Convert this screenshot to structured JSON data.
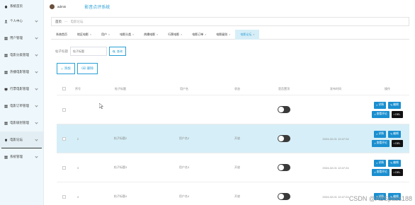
{
  "sidebar": {
    "logo_label": "系统首页",
    "items": [
      {
        "label": "个人中心",
        "icon": "user-icon"
      },
      {
        "label": "用户管理",
        "icon": "grid-icon"
      },
      {
        "label": "电影分类管理",
        "icon": "grid-icon"
      },
      {
        "label": "热播电影管理",
        "icon": "grid-icon"
      },
      {
        "label": "行票电影管理",
        "icon": "monitor-icon"
      },
      {
        "label": "电影订单管理",
        "icon": "grid-icon"
      },
      {
        "label": "电影级别管理",
        "icon": "grid-icon"
      },
      {
        "label": "电影论坛",
        "icon": "pin-icon"
      },
      {
        "label": "系统管理",
        "icon": "grid-icon"
      }
    ]
  },
  "topbar": {
    "username": "admin",
    "system_title": "影音点评系统"
  },
  "breadcrumb": {
    "home": "首页",
    "current": "电影论坛"
  },
  "tabs": [
    "系统首页",
    "地区电影",
    "用户",
    "电影分类",
    "热播电影",
    "行票电影",
    "电影订单",
    "电影级别",
    "电影论坛"
  ],
  "search": {
    "label": "帖子标题",
    "placeholder": "帖子标题",
    "button": "查询"
  },
  "actions": {
    "add": "添加",
    "delete": "删除"
  },
  "table": {
    "headers": [
      "序号",
      "帖子标题",
      "用户名",
      "状态",
      "是否置顶",
      "发布时间",
      "操作"
    ],
    "rows": [
      {
        "index": "",
        "title": "",
        "user": "",
        "status": "",
        "time": ""
      },
      {
        "index": "2",
        "title": "帖子标题2",
        "user": "用户名2",
        "status": "开放",
        "time": "2024-02-01 12:47:24"
      },
      {
        "index": "3",
        "title": "帖子标题3",
        "user": "用户名3",
        "status": "开放",
        "time": "2024-02-01 12:47:24"
      },
      {
        "index": "4",
        "title": "帖子标题4",
        "user": "用户名4",
        "status": "开放",
        "time": "2024-02-01 12:47:24"
      }
    ],
    "op_labels": {
      "detail": "详情",
      "edit": "编辑",
      "comments": "查看评论",
      "del": "DEL"
    }
  },
  "watermark": "CSDN @ABSpass188",
  "colors": {
    "accent": "#2a9fd6",
    "selected_row": "#d6eef7",
    "sidebar": "#eef7fb"
  }
}
